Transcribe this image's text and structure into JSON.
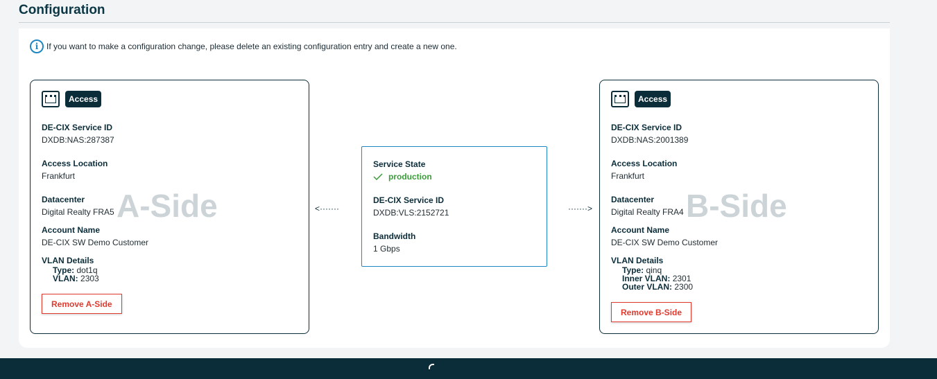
{
  "page": {
    "title": "Configuration"
  },
  "info": {
    "text": "If you want to make a configuration change, please delete an existing configuration entry and create a new one.",
    "icon": "info-icon"
  },
  "a_side": {
    "badge": "Access",
    "service_id_label": "DE-CIX Service ID",
    "service_id": "DXDB:NAS:287387",
    "location_label": "Access Location",
    "location": "Frankfurt",
    "datacenter_label": "Datacenter",
    "datacenter": "Digital Realty FRA5",
    "account_label": "Account Name",
    "account": "DE-CIX SW Demo Customer",
    "vlan_label": "VLAN Details",
    "vlan_rows": [
      {
        "key": "Type:",
        "value": "dot1q"
      },
      {
        "key": "VLAN:",
        "value": "2303"
      }
    ],
    "watermark": "A-Side",
    "remove_label": "Remove A-Side"
  },
  "b_side": {
    "badge": "Access",
    "service_id_label": "DE-CIX Service ID",
    "service_id": "DXDB:NAS:2001389",
    "location_label": "Access Location",
    "location": "Frankfurt",
    "datacenter_label": "Datacenter",
    "datacenter": "Digital Realty FRA4",
    "account_label": "Account Name",
    "account": "DE-CIX SW Demo Customer",
    "vlan_label": "VLAN Details",
    "vlan_rows": [
      {
        "key": "Type:",
        "value": "qinq"
      },
      {
        "key": "Inner VLAN:",
        "value": "2301"
      },
      {
        "key": "Outer VLAN:",
        "value": "2300"
      }
    ],
    "watermark": "B-Side",
    "remove_label": "Remove B-Side"
  },
  "service": {
    "state_label": "Service State",
    "state": "production",
    "service_id_label": "DE-CIX Service ID",
    "service_id": "DXDB:VLS:2152721",
    "bandwidth_label": "Bandwidth",
    "bandwidth": "1 Gbps"
  },
  "arrows": {
    "left": "<·······",
    "right": "·······>"
  },
  "colors": {
    "primary": "#0b2d3a",
    "accent": "#1e86c0",
    "success": "#3a9d3a",
    "danger": "#e03a2f",
    "watermark": "#cdd4d8"
  }
}
